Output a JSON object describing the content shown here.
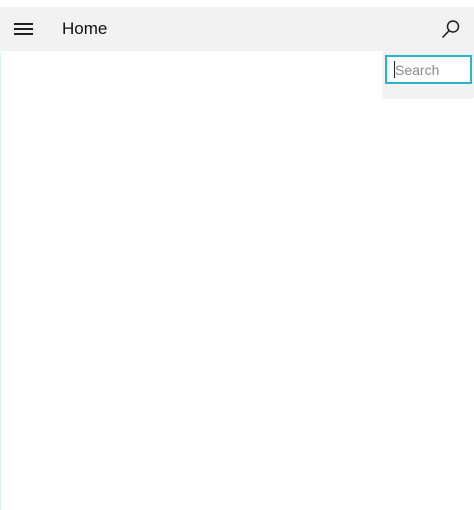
{
  "app_bar": {
    "title": "Home",
    "menu_icon": "hamburger-menu-icon",
    "search_icon": "search-icon",
    "background": "#f2f2f2"
  },
  "search": {
    "placeholder": "Search",
    "value": "",
    "accent_color": "#29b6c8"
  },
  "colors": {
    "page_background": "#ffffff",
    "text": "#111111"
  }
}
